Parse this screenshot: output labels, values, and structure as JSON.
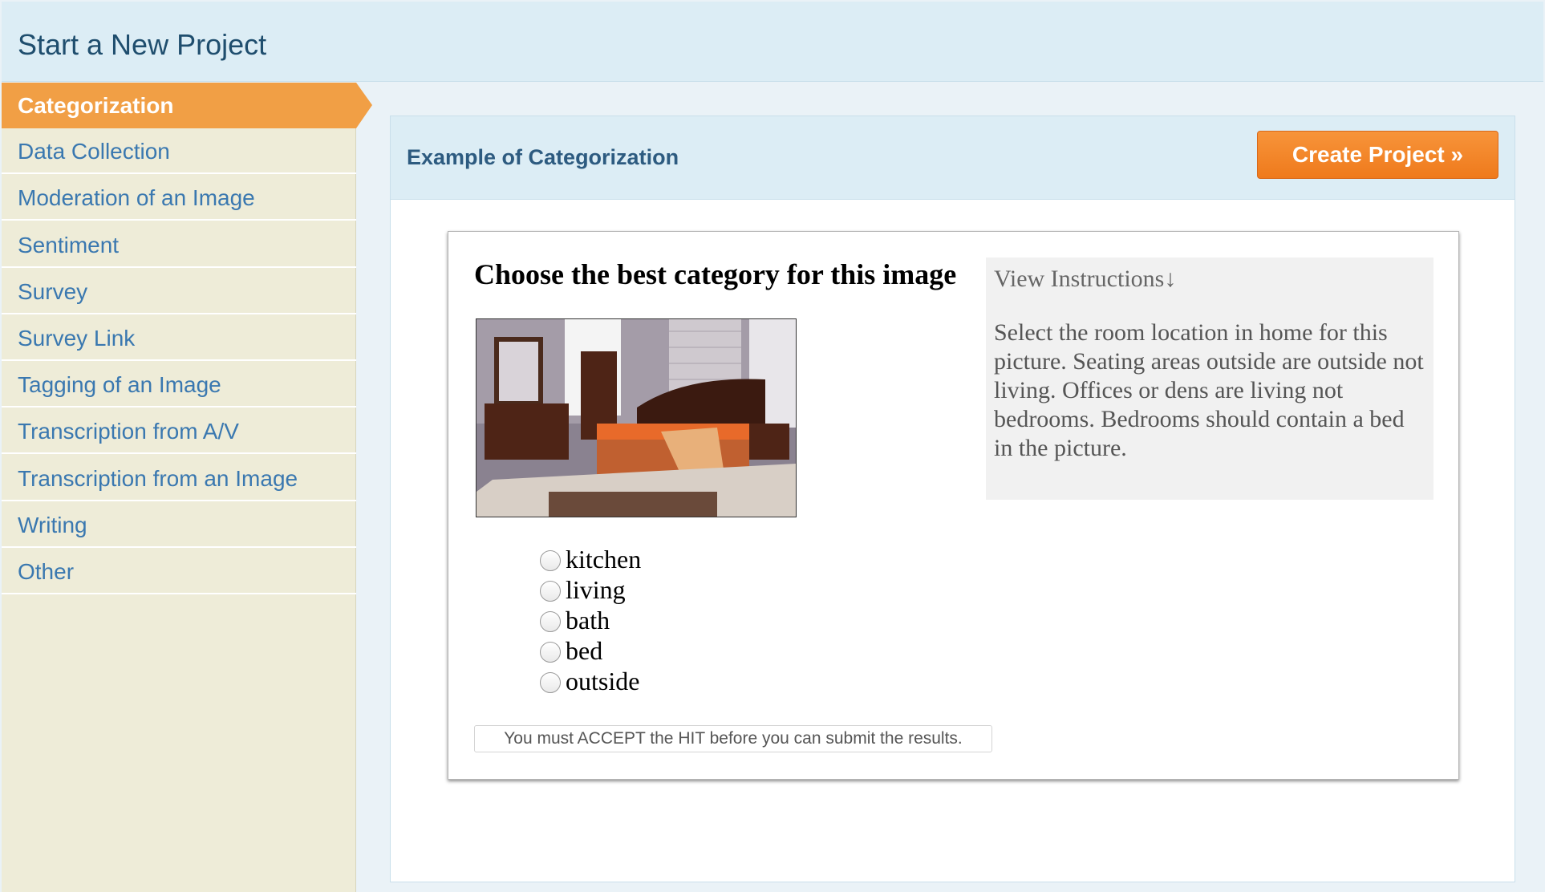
{
  "header": {
    "title": "Start a New Project"
  },
  "sidebar": {
    "items": [
      {
        "label": "Categorization",
        "active": true
      },
      {
        "label": "Data Collection"
      },
      {
        "label": "Moderation of an Image"
      },
      {
        "label": "Sentiment"
      },
      {
        "label": "Survey"
      },
      {
        "label": "Survey Link"
      },
      {
        "label": "Tagging of an Image"
      },
      {
        "label": "Transcription from A/V"
      },
      {
        "label": "Transcription from an Image"
      },
      {
        "label": "Writing"
      },
      {
        "label": "Other"
      }
    ]
  },
  "main": {
    "title": "Example of Categorization",
    "create_button": "Create Project »"
  },
  "hit": {
    "question": "Choose the best category for this image",
    "instructions_toggle": "View Instructions↓",
    "instructions_text": "Select the room location in home for this picture. Seating areas outside are outside not living. Offices or dens are living not bedrooms. Bedrooms should contain a bed in the picture.",
    "options": [
      "kitchen",
      "living",
      "bath",
      "bed",
      "outside"
    ],
    "submit_note": "You must ACCEPT the HIT before you can submit the results."
  },
  "colors": {
    "accent_orange": "#f19f45",
    "button_orange": "#ef7a1c",
    "link_blue": "#3a78b0",
    "header_bg": "#dcedf5",
    "sidebar_bg": "#eeecd8"
  }
}
